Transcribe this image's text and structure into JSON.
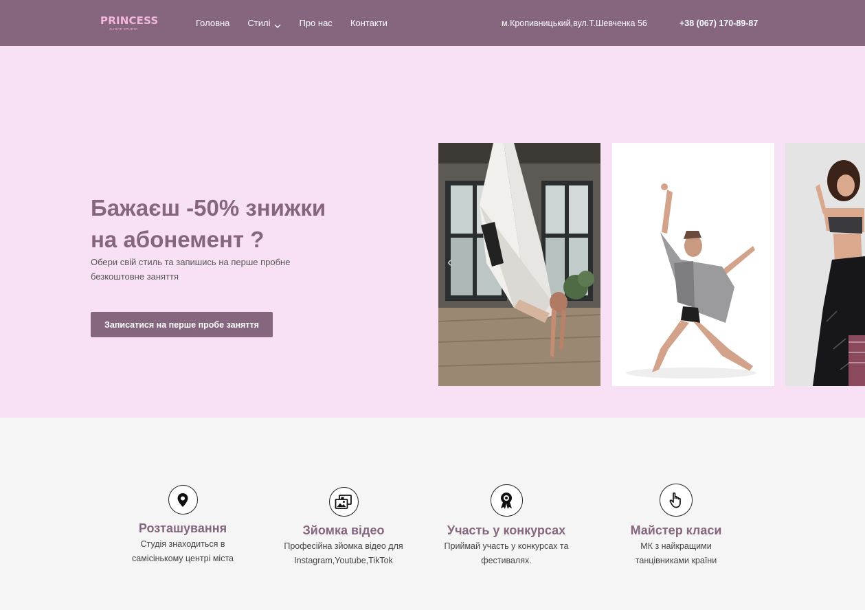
{
  "header": {
    "logo": {
      "main": "PRINCESS",
      "sub": "DANCE STUDIO"
    },
    "nav": [
      {
        "label": "Головна"
      },
      {
        "label": "Стилі",
        "has_dropdown": true
      },
      {
        "label": "Про нас"
      },
      {
        "label": "Контакти"
      }
    ],
    "address": "м.Кропивницький,вул.Т.Шевченка 56",
    "phone": "+38 (067) 170-89-87"
  },
  "hero": {
    "title": "Бажаєш -50% знижки на абонемент ?",
    "subtitle": "Обери свій стиль та запишись на перше пробне безкоштовне заняття",
    "cta_label": "Записатися на перше пробе заняття",
    "prev_arrow": "‹"
  },
  "features": [
    {
      "icon": "location-pin-icon",
      "title": "Розташування",
      "text": "Студія знаходиться в самісінькому центрі міста"
    },
    {
      "icon": "photo-video-icon",
      "title": "Зйомка відео",
      "text": "Професійна зйомка відео для Instagram,Youtube,TikTok"
    },
    {
      "icon": "award-ribbon-icon",
      "title": "Участь у конкурсах",
      "text": "Приймай участь у конкурсах та фестивалях."
    },
    {
      "icon": "hand-pointer-icon",
      "title": "Майстер класи",
      "text": "МК з найкращими танцівниками країни"
    }
  ],
  "colors": {
    "header_bg": "#86667f",
    "hero_bg": "#f8e0f5",
    "accent": "#86667f",
    "logo": "#f3b6dd",
    "features_bg": "#f5f5f5"
  }
}
